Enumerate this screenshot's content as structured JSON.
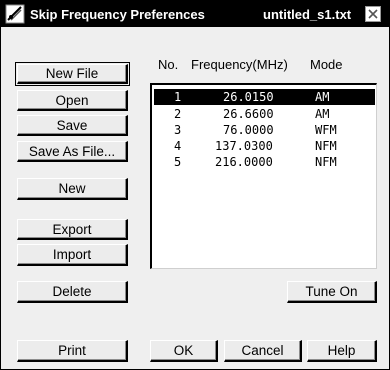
{
  "window": {
    "title": "Skip Frequency Preferences",
    "filename": "untitled_s1.txt"
  },
  "sidebar_buttons": {
    "new_file": "New File",
    "open": "Open",
    "save": "Save",
    "save_as": "Save As File...",
    "new": "New",
    "export": "Export",
    "import": "Import",
    "delete": "Delete",
    "print": "Print"
  },
  "table": {
    "headers": {
      "no": "No.",
      "frequency": "Frequency(MHz)",
      "mode": "Mode"
    },
    "rows": [
      {
        "no": "1",
        "frequency": "26.0150",
        "mode": "AM",
        "selected": true
      },
      {
        "no": "2",
        "frequency": "26.6600",
        "mode": "AM"
      },
      {
        "no": "3",
        "frequency": "76.0000",
        "mode": "WFM"
      },
      {
        "no": "4",
        "frequency": "137.0300",
        "mode": "NFM"
      },
      {
        "no": "5",
        "frequency": "216.0000",
        "mode": "NFM"
      }
    ]
  },
  "action_buttons": {
    "tune_on": "Tune On",
    "ok": "OK",
    "cancel": "Cancel",
    "help": "Help"
  },
  "icons": {
    "app": "radio-app-icon",
    "close": "close-icon"
  }
}
